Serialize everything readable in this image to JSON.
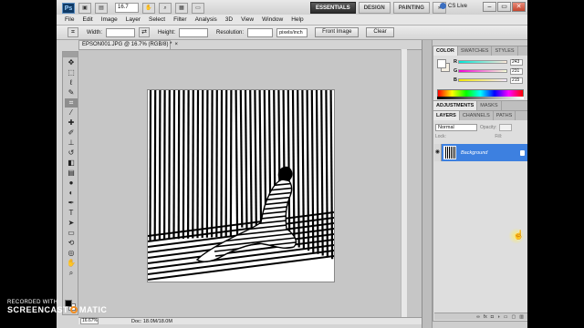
{
  "app": {
    "logo": "Ps",
    "zoom": "16.7",
    "workspaces": [
      "ESSENTIALS",
      "DESIGN",
      "PAINTING",
      "»"
    ],
    "cs_live": "CS Live",
    "window_controls": [
      "–",
      "▭",
      "✕"
    ]
  },
  "menu": [
    "File",
    "Edit",
    "Image",
    "Layer",
    "Select",
    "Filter",
    "Analysis",
    "3D",
    "View",
    "Window",
    "Help"
  ],
  "options": {
    "width_label": "Width:",
    "height_label": "Height:",
    "resolution_label": "Resolution:",
    "resolution_unit": "pixels/inch",
    "front_image": "Front Image",
    "clear": "Clear"
  },
  "document": {
    "tab_title": "EPSON001.JPG @ 16.7% (RGB/8) *",
    "close": "×",
    "status_zoom": "16.67%",
    "status_doc": "Doc: 18.0M/18.0M"
  },
  "panels": {
    "color_tabs": [
      "COLOR",
      "SWATCHES",
      "STYLES"
    ],
    "rgb": [
      {
        "channel": "R",
        "value": "243",
        "color": "#f3"
      },
      {
        "channel": "G",
        "value": "231",
        "color": "#e7"
      },
      {
        "channel": "B",
        "value": "215",
        "color": "#d7"
      }
    ],
    "adjust_tabs": [
      "ADJUSTMENTS",
      "MASKS"
    ],
    "layer_tabs": [
      "LAYERS",
      "CHANNELS",
      "PATHS"
    ],
    "blend_mode": "Normal",
    "opacity_label": "Opacity:",
    "lock_label": "Lock:",
    "fill_label": "Fill:",
    "layer_name": "Background"
  },
  "watermark": {
    "top": "RECORDED WITH",
    "left": "SCREENCAST",
    "right": "MATIC"
  }
}
